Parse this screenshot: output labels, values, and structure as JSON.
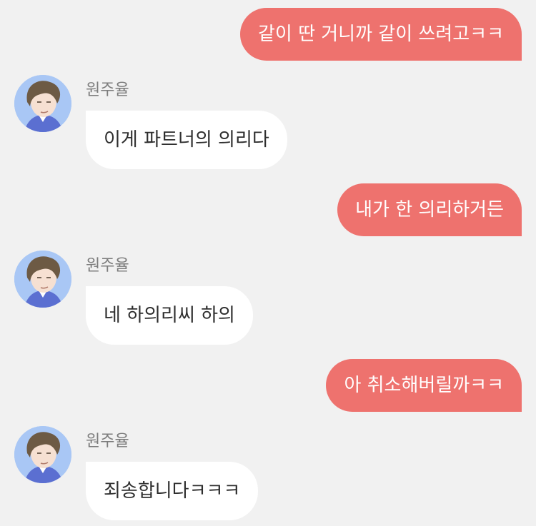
{
  "chat": {
    "messages": [
      {
        "sender": "me",
        "text": "같이 딴 거니까 같이 쓰려고ㅋㅋ"
      },
      {
        "sender": "원주율",
        "text": "이게 파트너의 의리다"
      },
      {
        "sender": "me",
        "text": "내가 한 의리하거든"
      },
      {
        "sender": "원주율",
        "text": "네 하의리씨 하의"
      },
      {
        "sender": "me",
        "text": "아 취소해버릴까ㅋㅋ"
      },
      {
        "sender": "원주율",
        "text": "죄송합니다ㅋㅋㅋ"
      }
    ]
  },
  "colors": {
    "background": "#f1f1f1",
    "outgoing_bubble": "#ee726e",
    "incoming_bubble": "#ffffff",
    "sender_name": "#7c7c7c"
  },
  "icons": {
    "avatar": "avatar-icon"
  }
}
